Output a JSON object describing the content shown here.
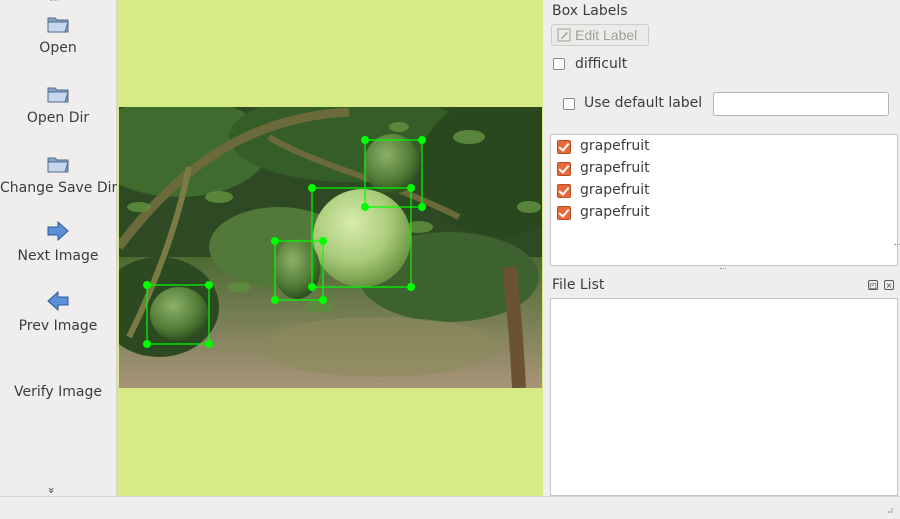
{
  "toolbar": {
    "items": [
      {
        "label": "Open",
        "icon": "folder-icon"
      },
      {
        "label": "Open Dir",
        "icon": "folder-icon"
      },
      {
        "label": "Change Save Dir",
        "icon": "folder-icon"
      },
      {
        "label": "Next Image",
        "icon": "arrow-right-icon"
      },
      {
        "label": "Prev Image",
        "icon": "arrow-left-icon"
      },
      {
        "label": "Verify Image",
        "icon": ""
      }
    ],
    "more_glyph": "»"
  },
  "box_labels": {
    "title": "Box Labels",
    "edit_label_button": "Edit Label",
    "difficult_label": "difficult",
    "use_default_label": "Use default label",
    "default_label_value": "",
    "labels": [
      {
        "text": "grapefruit",
        "checked": true
      },
      {
        "text": "grapefruit",
        "checked": true
      },
      {
        "text": "grapefruit",
        "checked": true
      },
      {
        "text": "grapefruit",
        "checked": true
      }
    ]
  },
  "file_list": {
    "title": "File List",
    "items": []
  },
  "colors": {
    "canvas_background": "#d6eb86",
    "box_color": "#00ff00",
    "label_checkbox": "#e9683a"
  }
}
